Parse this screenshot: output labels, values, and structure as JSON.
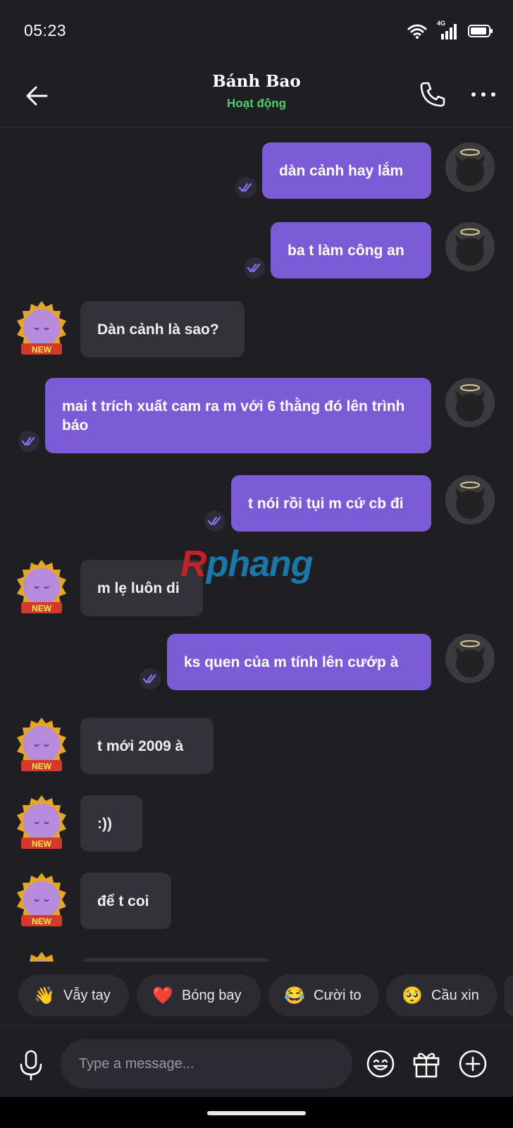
{
  "status_bar": {
    "time": "05:23",
    "network": "4G"
  },
  "header": {
    "contact_name": "Bánh Bao",
    "contact_status": "Hoạt động"
  },
  "messages": [
    {
      "direction": "out",
      "text": "dàn cảnh hay lắm"
    },
    {
      "direction": "out",
      "text": "ba t làm công an"
    },
    {
      "direction": "in",
      "text": "Dàn cảnh là sao?"
    },
    {
      "direction": "out",
      "text": "mai t trích xuất cam ra m với 6 thằng đó lên trình báo"
    },
    {
      "direction": "out",
      "text": "t nói rồi tụi m cứ cb đi"
    },
    {
      "direction": "in",
      "text": "m lẹ luôn di"
    },
    {
      "direction": "out",
      "text": "ks quen của m tính lên cướp à"
    },
    {
      "direction": "in",
      "text": "t mới 2009 à"
    },
    {
      "direction": "in",
      "text": ":))"
    },
    {
      "direction": "in",
      "text": "để t coi"
    }
  ],
  "avatar_badge": "NEW",
  "watermark": {
    "part1": "R",
    "part2": "phang"
  },
  "quick_replies": [
    {
      "emoji": "👋",
      "label": "Vẫy tay"
    },
    {
      "emoji": "❤️",
      "label": "Bóng bay"
    },
    {
      "emoji": "😂",
      "label": "Cười to"
    },
    {
      "emoji": "🥺",
      "label": "Cầu xin"
    }
  ],
  "composer": {
    "placeholder": "Type a message..."
  },
  "colors": {
    "background": "#1f1e23",
    "outgoing_bubble": "#7b5bd6",
    "incoming_bubble": "#333238",
    "status_online": "#4fce6d"
  },
  "icons": [
    "back-arrow-icon",
    "phone-icon",
    "more-icon",
    "double-check-icon",
    "microphone-icon",
    "emoji-icon",
    "gift-icon",
    "plus-icon"
  ]
}
